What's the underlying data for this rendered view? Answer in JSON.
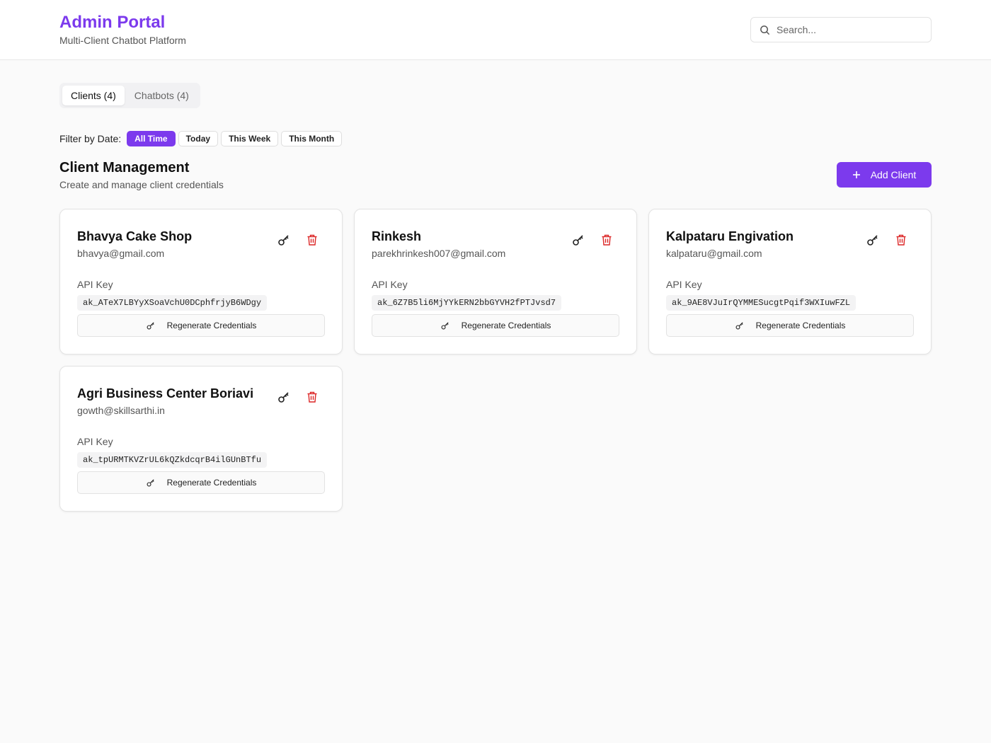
{
  "header": {
    "title": "Admin Portal",
    "subtitle": "Multi-Client Chatbot Platform",
    "search_placeholder": "Search...",
    "search_value": ""
  },
  "tabs": [
    {
      "label": "Clients (4)",
      "active": true
    },
    {
      "label": "Chatbots (4)",
      "active": false
    }
  ],
  "filter": {
    "label": "Filter by Date:",
    "options": [
      {
        "label": "All Time",
        "active": true
      },
      {
        "label": "Today",
        "active": false
      },
      {
        "label": "This Week",
        "active": false
      },
      {
        "label": "This Month",
        "active": false
      }
    ]
  },
  "section": {
    "title": "Client Management",
    "subtitle": "Create and manage client credentials",
    "add_button": "Add Client"
  },
  "api_key_label": "API Key",
  "regenerate_label": "Regenerate Credentials",
  "clients": [
    {
      "name": "Bhavya Cake Shop",
      "email": "bhavya@gmail.com",
      "api_key": "ak_ATeX7LBYyXSoaVchU0DCphfrjyB6WDgy"
    },
    {
      "name": "Rinkesh",
      "email": "parekhrinkesh007@gmail.com",
      "api_key": "ak_6Z7B5li6MjYYkERN2bbGYVH2fPTJvsd7"
    },
    {
      "name": "Kalpataru Engivation",
      "email": "kalpataru@gmail.com",
      "api_key": "ak_9AE8VJuIrQYMMESucgtPqif3WXIuwFZL"
    },
    {
      "name": "Agri Business Center Boriavi",
      "email": "gowth@skillsarthi.in",
      "api_key": "ak_tpURMTKVZrUL6kQZkdcqrB4ilGUnBTfu"
    }
  ],
  "colors": {
    "accent": "#7c3aed",
    "danger": "#dc2626",
    "background": "#fafafa"
  },
  "icons": {
    "search": "search-icon",
    "add": "plus-icon",
    "key": "key-icon",
    "delete": "trash-icon"
  }
}
